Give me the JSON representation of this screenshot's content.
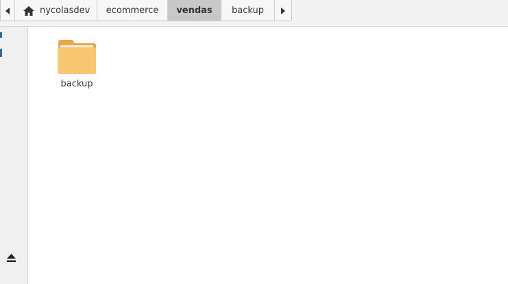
{
  "pathbar": {
    "back_icon": "chevron-left-icon",
    "home_icon": "home-icon",
    "segments": [
      "nycolasdev",
      "ecommerce",
      "vendas",
      "backup"
    ],
    "active_segment": "vendas",
    "forward_icon": "chevron-right-icon"
  },
  "sidebar": {
    "eject_icon": "eject-icon"
  },
  "files": [
    {
      "name": "backup",
      "type": "folder",
      "icon": "folder-icon"
    }
  ],
  "colors": {
    "folder_body": "#f8c671",
    "folder_tab": "#e6a94b",
    "active_segment_bg": "#c8c8c8",
    "accent": "#3465a4"
  }
}
